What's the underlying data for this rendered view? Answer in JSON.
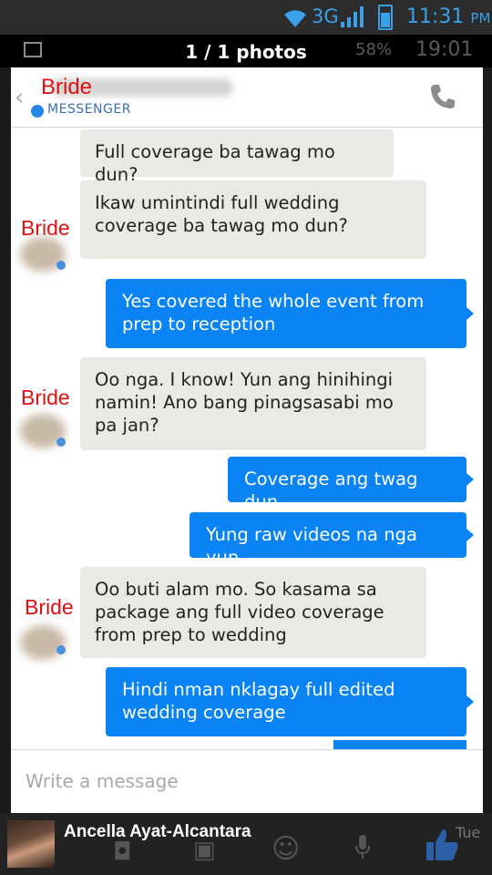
{
  "statusbar": {
    "network": "3G",
    "time": "11:31",
    "ampm": "PM"
  },
  "viewer": {
    "photo_count": "1 / 1 photos",
    "ghost_battery": "58%",
    "ghost_time": "19:01"
  },
  "header": {
    "annotation": "Bride",
    "app_label": "MESSENGER"
  },
  "messages": [
    {
      "side": "in",
      "text": "Full coverage ba tawag mo dun?"
    },
    {
      "side": "in",
      "text": "Ikaw umintindi full wedding coverage ba tawag mo dun?",
      "annotation": "Bride"
    },
    {
      "side": "out",
      "text": "Yes covered the whole event from prep to reception"
    },
    {
      "side": "in",
      "text": "Oo nga. I know! Yun ang hinihingi namin! Ano bang pinagsasabi mo pa jan?",
      "annotation": "Bride"
    },
    {
      "side": "out",
      "text": "Coverage ang twag dun"
    },
    {
      "side": "out",
      "text": "Yung raw videos na nga yun"
    },
    {
      "side": "in",
      "text": "Oo buti alam mo. So kasama sa package ang full video coverage from prep to wedding",
      "annotation": "Bride"
    },
    {
      "side": "out",
      "text": "Hindi nman nklagay full edited wedding coverage"
    }
  ],
  "compose": {
    "placeholder": "Write a message"
  },
  "fb": {
    "uploader_name": "Ancella Ayat-Alcantara",
    "day": "Tue",
    "like_color": "#2d5fa8"
  },
  "colors": {
    "outgoing_bubble": "#0a84f5",
    "incoming_bubble": "#ebe9e4",
    "annotation": "#e01010",
    "status_accent": "#3aa0e8"
  }
}
